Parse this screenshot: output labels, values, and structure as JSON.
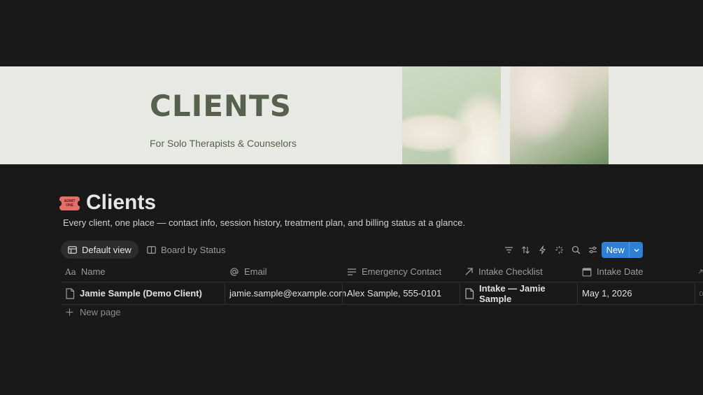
{
  "cover": {
    "title": "CLIENTS",
    "subtitle": "For Solo Therapists & Counselors"
  },
  "page": {
    "icon_text": "ADMIT ONE",
    "title": "Clients",
    "description": "Every client, one place — contact info, session history, treatment plan, and billing status at a glance."
  },
  "views": {
    "tabs": [
      {
        "label": "Default view",
        "icon": "table-icon",
        "active": true
      },
      {
        "label": "Board by Status",
        "icon": "board-icon",
        "active": false
      }
    ]
  },
  "toolbar": {
    "icons": [
      "filter-icon",
      "sort-icon",
      "automation-icon",
      "ai-sparkle-icon",
      "search-icon",
      "settings-sliders-icon"
    ],
    "new_label": "New"
  },
  "table": {
    "columns": [
      {
        "label": "Name",
        "icon": "text-icon"
      },
      {
        "label": "Email",
        "icon": "at-icon"
      },
      {
        "label": "Emergency Contact",
        "icon": "text-lines-icon"
      },
      {
        "label": "Intake Checklist",
        "icon": "relation-arrow-icon"
      },
      {
        "label": "Intake Date",
        "icon": "calendar-icon"
      }
    ],
    "rows": [
      {
        "name": "Jamie Sample (Demo Client)",
        "email": "jamie.sample@example.com",
        "emergency_contact": "Alex Sample, 555-0101",
        "intake_checklist": "Intake — Jamie Sample",
        "intake_date": "May 1, 2026"
      }
    ],
    "new_page_label": "New page"
  },
  "colors": {
    "background": "#191919",
    "accent": "#2e7fd6",
    "cover_text": "#56624e",
    "ticket": "#e46f6a"
  }
}
